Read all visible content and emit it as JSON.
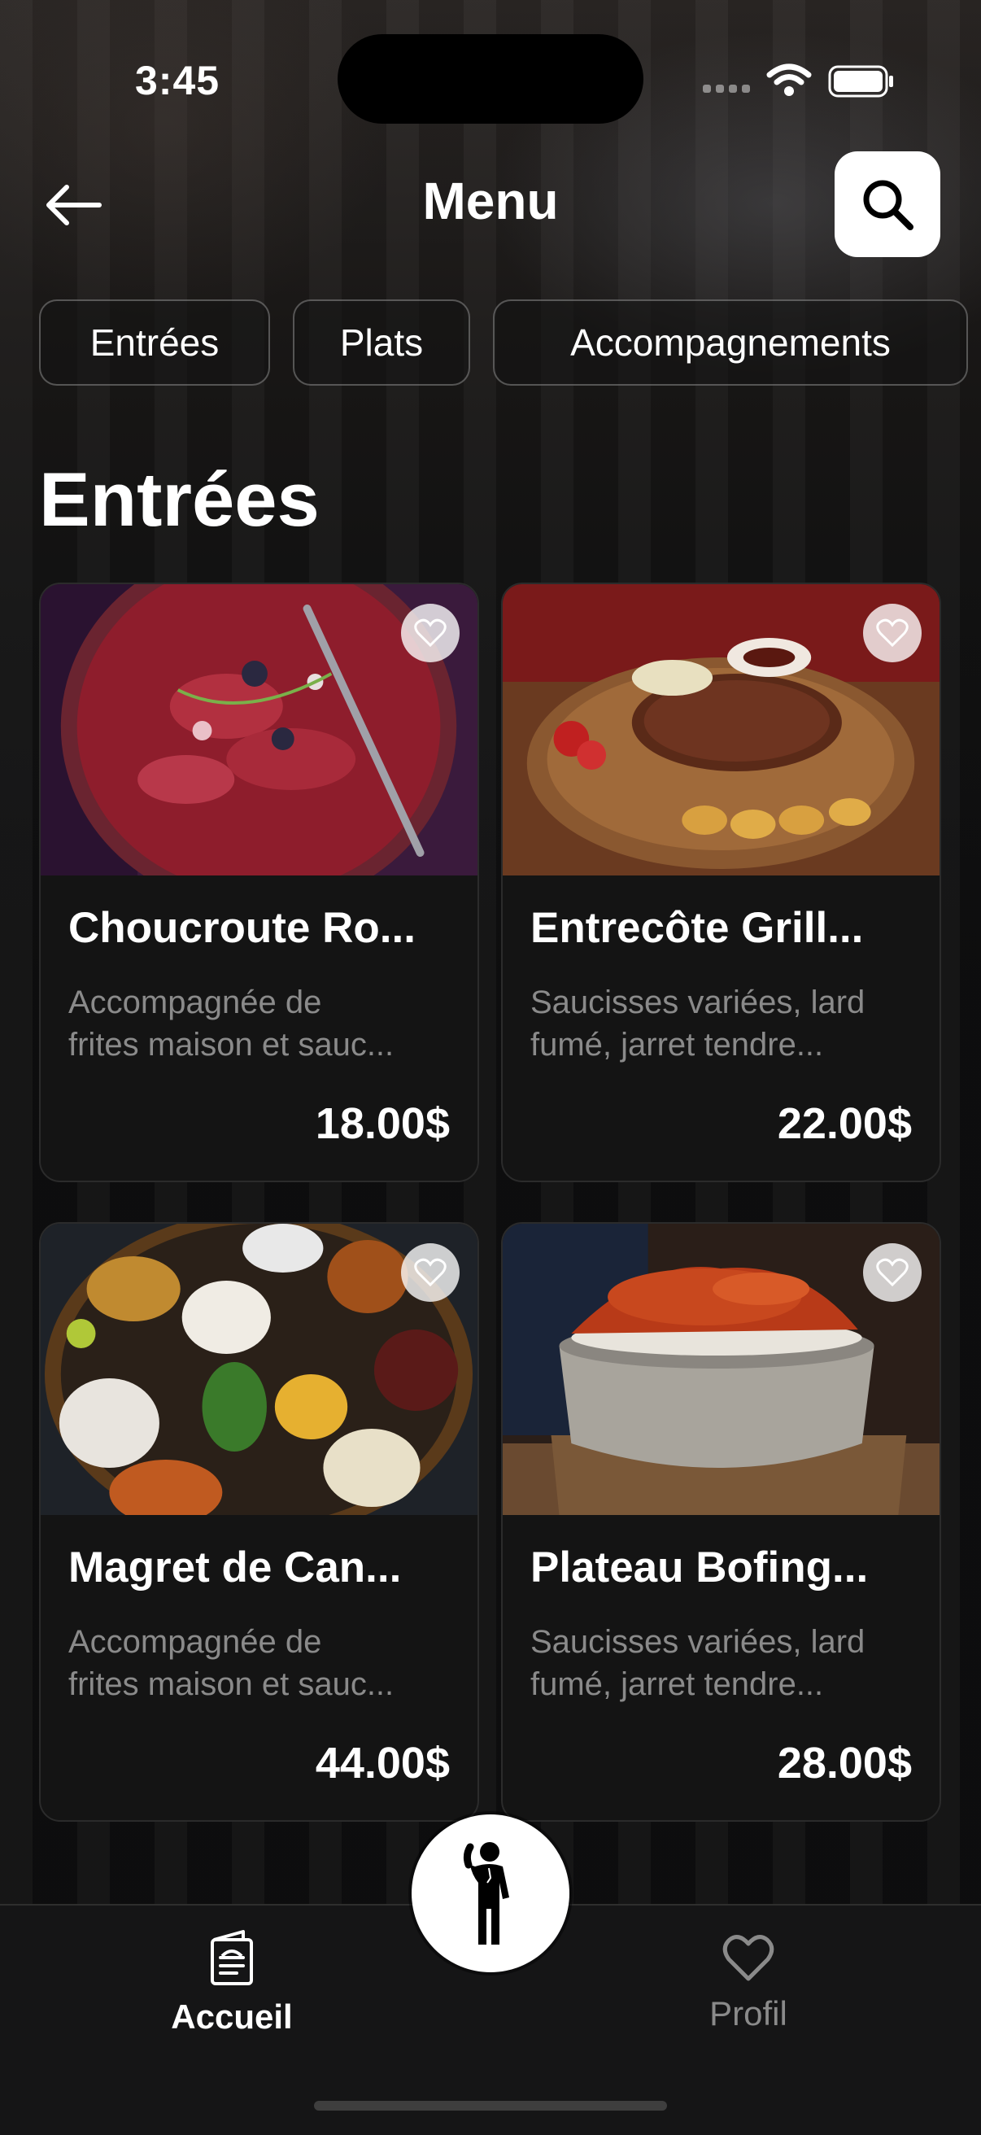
{
  "status_bar": {
    "time": "3:45"
  },
  "header": {
    "title": "Menu",
    "icons": [
      "back-arrow-icon",
      "search-icon"
    ]
  },
  "categories": [
    {
      "label": "Entrées"
    },
    {
      "label": "Plats"
    },
    {
      "label": "Accompagnements"
    }
  ],
  "section": {
    "title": "Entrées"
  },
  "items": [
    {
      "name": "Choucroute Ro...",
      "desc_line1": "Accompagnée de",
      "desc_line2": "frites maison et sauc...",
      "price": "18.00$",
      "image": "beef-carpaccio-photo"
    },
    {
      "name": "Entrecôte Grill...",
      "desc_line1": "Saucisses variées, lard",
      "desc_line2": "fumé, jarret tendre...",
      "price": "22.00$",
      "image": "grilled-steak-photo"
    },
    {
      "name": "Magret de Can...",
      "desc_line1": "Accompagnée de",
      "desc_line2": "frites maison et sauc...",
      "price": "44.00$",
      "image": "thali-platter-photo"
    },
    {
      "name": "Plateau Bofing...",
      "desc_line1": "Saucisses variées, lard",
      "desc_line2": "fumé, jarret tendre...",
      "price": "28.00$",
      "image": "rice-bowl-photo"
    }
  ],
  "bottom_nav": {
    "home": "Accueil",
    "profile": "Profil",
    "center_icon": "waiter-icon"
  },
  "colors": {
    "background": "#0e0e0f",
    "card": "#141414",
    "muted_text": "#8a8a8a",
    "inactive_nav": "#8a8a8a"
  }
}
